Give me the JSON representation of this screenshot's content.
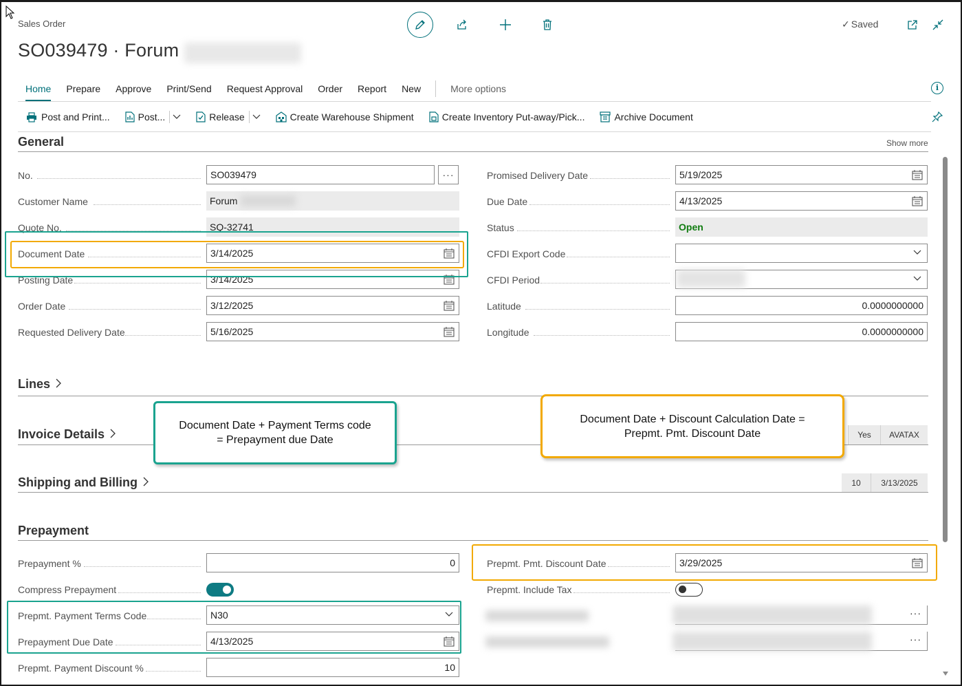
{
  "header": {
    "breadcrumb": "Sales Order",
    "title": "SO039479 · Forum",
    "saved_label": "Saved",
    "icons": [
      "edit-icon",
      "share-icon",
      "add-icon",
      "delete-icon",
      "open-new-window-icon",
      "collapse-icon"
    ]
  },
  "tabs": [
    {
      "label": "Home",
      "active": true
    },
    {
      "label": "Prepare"
    },
    {
      "label": "Approve"
    },
    {
      "label": "Print/Send"
    },
    {
      "label": "Request Approval"
    },
    {
      "label": "Order"
    },
    {
      "label": "Report"
    },
    {
      "label": "New"
    }
  ],
  "more_options": "More options",
  "toolbar": {
    "post_and_print": "Post and Print...",
    "post": "Post...",
    "release": "Release",
    "create_warehouse_shipment": "Create Warehouse Shipment",
    "create_inventory_putaway": "Create Inventory Put-away/Pick...",
    "archive_document": "Archive Document"
  },
  "general": {
    "title": "General",
    "show_more": "Show more",
    "left": {
      "no_label": "No.",
      "no_value": "SO039479",
      "lookup": "···",
      "customer_name_label": "Customer Name",
      "customer_name_value": "Forum",
      "quote_no_label": "Quote No.",
      "quote_no_value": "SQ-32741",
      "document_date_label": "Document Date",
      "document_date_value": "3/14/2025",
      "posting_date_label": "Posting Date",
      "posting_date_value": "3/14/2025",
      "order_date_label": "Order Date",
      "order_date_value": "3/12/2025",
      "requested_delivery_label": "Requested Delivery Date",
      "requested_delivery_value": "5/16/2025"
    },
    "right": {
      "promised_delivery_label": "Promised Delivery Date",
      "promised_delivery_value": "5/19/2025",
      "due_date_label": "Due Date",
      "due_date_value": "4/13/2025",
      "status_label": "Status",
      "status_value": "Open",
      "cfdi_export_label": "CFDI Export Code",
      "cfdi_export_value": "",
      "cfdi_period_label": "CFDI Period",
      "latitude_label": "Latitude",
      "latitude_value": "0.0000000000",
      "longitude_label": "Longitude",
      "longitude_value": "0.0000000000"
    }
  },
  "lines": {
    "title": "Lines"
  },
  "invoice_details": {
    "title": "Invoice Details",
    "pills": [
      "Yes",
      "AVATAX"
    ]
  },
  "shipping_billing": {
    "title": "Shipping and Billing",
    "pills": [
      "10",
      "3/13/2025"
    ]
  },
  "prepayment": {
    "title": "Prepayment",
    "prepayment_pct_label": "Prepayment %",
    "prepayment_pct_value": "0",
    "compress_label": "Compress Prepayment",
    "compress_on": true,
    "payment_terms_label": "Prepmt. Payment Terms Code",
    "payment_terms_value": "N30",
    "due_date_label": "Prepayment Due Date",
    "due_date_value": "4/13/2025",
    "payment_discount_label": "Prepmt. Payment Discount %",
    "payment_discount_value": "10",
    "pmt_discount_date_label": "Prepmt. Pmt. Discount Date",
    "pmt_discount_date_value": "3/29/2025",
    "include_tax_label": "Prepmt. Include Tax",
    "include_tax_on": false,
    "lookup": "···"
  },
  "callouts": {
    "teal_line1": "Document Date + Payment Terms code",
    "teal_line2": "= Prepayment due Date",
    "orange_line1": "Document Date + Discount Calculation Date =",
    "orange_line2": "Prepmt. Pmt. Discount Date"
  },
  "colors": {
    "accent": "#00707a",
    "status_open": "#107c10",
    "highlight_teal": "#1aa38f",
    "highlight_orange": "#f2a900"
  }
}
